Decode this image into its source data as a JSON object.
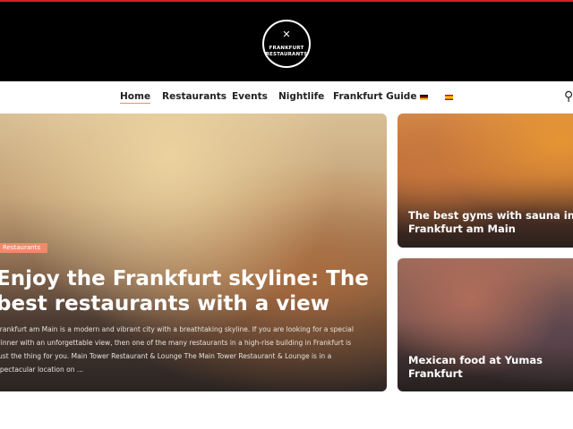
{
  "header": {
    "logo_line1": "FRANKFURT",
    "logo_line2": "RESTAURANTS",
    "logo_icon": "cutlery-icon",
    "top_border_color": "#d81e2a"
  },
  "nav": {
    "items": [
      {
        "label": "Home",
        "active": true
      },
      {
        "label": "Restaurants"
      },
      {
        "label": "Events"
      },
      {
        "label": "Nightlife"
      },
      {
        "label": "Frankfurt Guide"
      }
    ],
    "flags": [
      "german-flag-icon",
      "spanish-flag-icon"
    ],
    "search_icon": "search-icon"
  },
  "featured": {
    "category": "Restaurants",
    "title": "Enjoy the Frankfurt skyline: The best restaurants with a view",
    "excerpt": "Frankfurt am Main is a modern and vibrant city with a breathtaking skyline. If you are looking for a special dinner with an unforgettable view, then one of the many restaurants in a high-rise building in Frankfurt is just the thing for you. Main Tower Restaurant & Lounge The Main Tower Restaurant & Lounge is in a spectacular location on ..."
  },
  "side_posts": [
    {
      "title": "The best gyms with sauna in Frankfurt am Main"
    },
    {
      "title": "Mexican food at Yumas Frankfurt"
    }
  ],
  "colors": {
    "accent": "#f08a6b",
    "header_bg": "#000000"
  }
}
